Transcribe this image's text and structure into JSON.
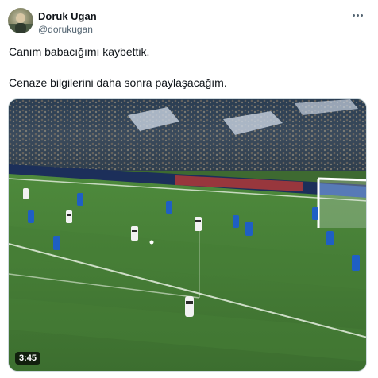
{
  "user": {
    "display_name": "Doruk Ugan",
    "handle": "@dorukugan",
    "avatar_icon": "profile-photo"
  },
  "menu_icon": "more-horizontal-icon",
  "tweet": {
    "line1": "Canım babacığımı kaybettik.",
    "line2": "Cenaze bilgilerini daha sonra paylaşacağım."
  },
  "video": {
    "duration": "3:45",
    "content": "football-match-footage"
  },
  "colors": {
    "text": "#0f1419",
    "secondary": "#536471",
    "border": "#cfd9de",
    "pitch": "#3e6a31",
    "home_kit": "#1f5fc4",
    "away_kit": "#f2f2f2"
  }
}
